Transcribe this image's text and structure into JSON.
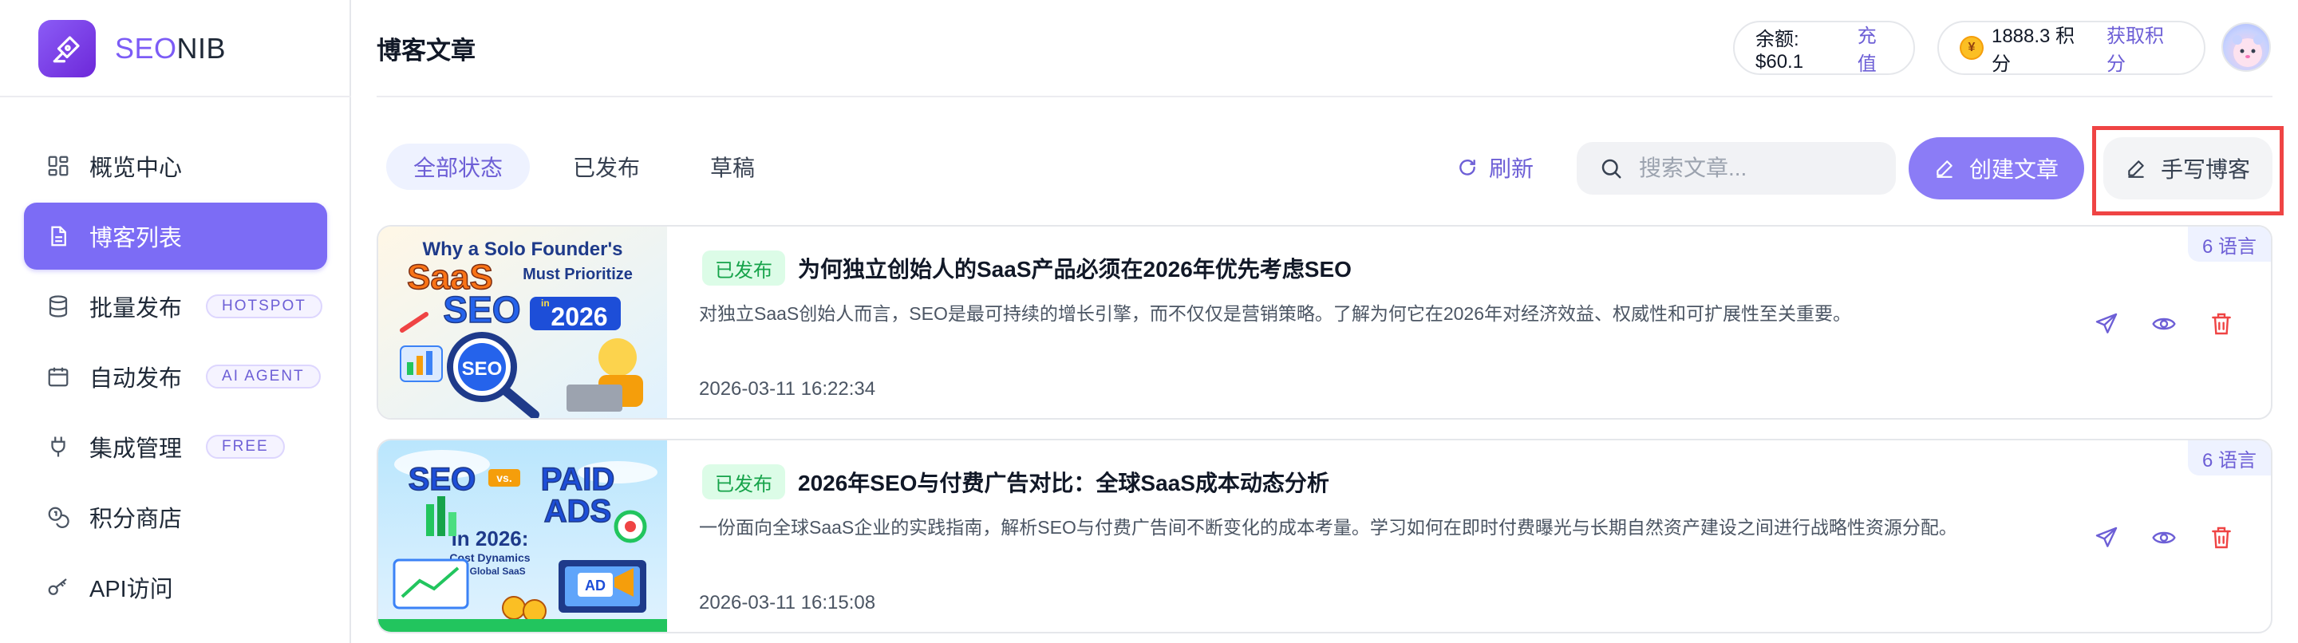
{
  "brand": {
    "name_part1": "SEO",
    "name_part2": "NIB"
  },
  "sidebar": {
    "items": [
      {
        "label": "概览中心",
        "icon": "dashboard-icon"
      },
      {
        "label": "博客列表",
        "icon": "document-icon",
        "active": true
      },
      {
        "label": "批量发布",
        "icon": "database-icon",
        "badge": "HOTSPOT"
      },
      {
        "label": "自动发布",
        "icon": "calendar-icon",
        "badge": "AI AGENT"
      },
      {
        "label": "集成管理",
        "icon": "plug-icon",
        "badge": "FREE"
      },
      {
        "label": "积分商店",
        "icon": "coins-icon"
      },
      {
        "label": "API访问",
        "icon": "key-icon"
      }
    ]
  },
  "header": {
    "title": "博客文章",
    "balance_label": "余额: $60.1",
    "recharge": "充值",
    "points_label": "1888.3 积分",
    "get_points": "获取积分"
  },
  "toolbar": {
    "tabs": [
      "全部状态",
      "已发布",
      "草稿"
    ],
    "active_tab": "全部状态",
    "refresh": "刷新",
    "search_placeholder": "搜索文章...",
    "create": "创建文章",
    "write": "手写博客"
  },
  "articles": [
    {
      "status": "已发布",
      "title": "为何独立创始人的SaaS产品必须在2026年优先考虑SEO",
      "summary": "对独立SaaS创始人而言，SEO是最可持续的增长引擎，而不仅仅是营销策略。了解为何它在2026年对经济效益、权威性和可扩展性至关重要。",
      "date": "2026-03-11 16:22:34",
      "languages": "6 语言",
      "thumb": {
        "line1": "Why a Solo Founder's",
        "line2": "SaaS",
        "line3": "Must Prioritize",
        "line4": "SEO",
        "line5": "in",
        "line6": "2026",
        "badge": "SEO"
      }
    },
    {
      "status": "已发布",
      "title": "2026年SEO与付费广告对比：全球SaaS成本动态分析",
      "summary": "一份面向全球SaaS企业的实践指南，解析SEO与付费广告间不断变化的成本考量。学习如何在即时付费曝光与长期自然资产建设之间进行战略性资源分配。",
      "date": "2026-03-11 16:15:08",
      "languages": "6 语言",
      "thumb": {
        "line1": "SEO",
        "line2": "vs.",
        "line3": "PAID",
        "line4": "ADS",
        "line5": "in 2026:",
        "line6": "Cost Dynamics",
        "line7": "for Global SaaS",
        "badge": "AD"
      }
    }
  ],
  "colors": {
    "accent": "#7c6cf5",
    "published": "#16a34a",
    "danger": "#ef4444"
  }
}
